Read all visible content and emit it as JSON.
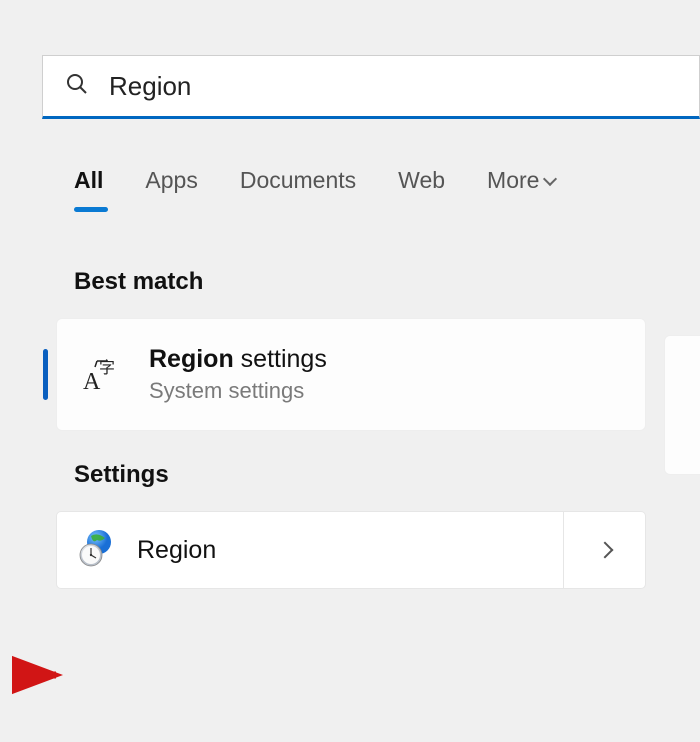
{
  "search": {
    "query": "Region"
  },
  "tabs": [
    {
      "label": "All",
      "active": true
    },
    {
      "label": "Apps",
      "active": false
    },
    {
      "label": "Documents",
      "active": false
    },
    {
      "label": "Web",
      "active": false
    },
    {
      "label": "More",
      "active": false,
      "has_chevron": true
    }
  ],
  "sections": {
    "best_match": {
      "header": "Best match",
      "result": {
        "title_bold": "Region",
        "title_rest": " settings",
        "subtitle": "System settings",
        "icon": "language-settings-icon"
      }
    },
    "settings": {
      "header": "Settings",
      "result": {
        "label": "Region",
        "icon": "globe-clock-icon"
      }
    }
  },
  "colors": {
    "accent": "#0a7ad3",
    "underline": "#0067c0",
    "annotation": "#d11515"
  }
}
